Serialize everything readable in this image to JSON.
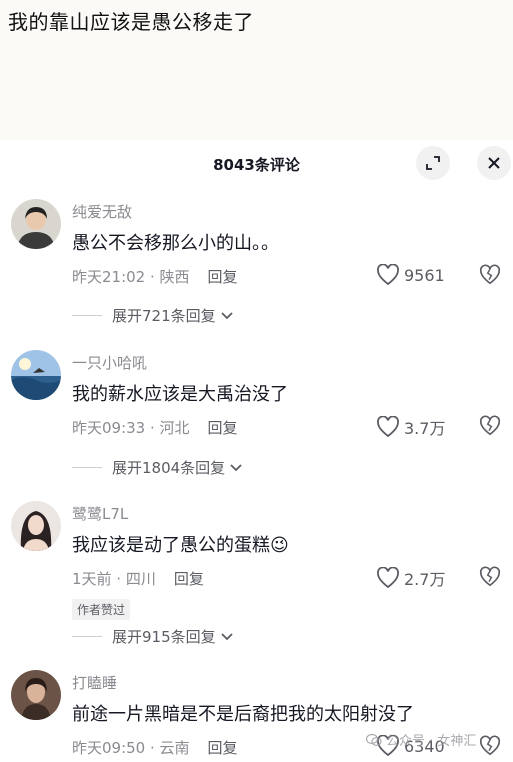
{
  "post": {
    "title": "我的靠山应该是愚公移走了"
  },
  "sheet": {
    "count_title": "8043条评论"
  },
  "comments": [
    {
      "user": "纯爱无敌",
      "text": "愚公不会移那么小的山。。",
      "time_loc": "昨天21:02 · 陕西",
      "reply": "回复",
      "likes": "9561",
      "expand": "展开721条回复"
    },
    {
      "user": "一只小哈吼",
      "text": "我的薪水应该是大禹治没了",
      "time_loc": "昨天09:33 · 河北",
      "reply": "回复",
      "likes": "3.7万",
      "expand": "展开1804条回复"
    },
    {
      "user": "鹭鹭L7L",
      "text": "我应该是动了愚公的蛋糕",
      "emoji": "😉",
      "time_loc": "1天前 · 四川",
      "reply": "回复",
      "likes": "2.7万",
      "author_tag": "作者赞过",
      "expand": "展开915条回复"
    },
    {
      "user": "打瞌睡",
      "text": "前途一片黑暗是不是后裔把我的太阳射没了",
      "time_loc": "昨天09:50 · 云南",
      "reply": "回复",
      "likes": "6340"
    }
  ],
  "watermark": {
    "text": "公众号 · 女神汇"
  },
  "icons": {
    "expand": "expand-arrows-icon",
    "close": "close-icon",
    "like": "heart-icon",
    "dislike": "broken-heart-icon",
    "chevron": "chevron-down-icon"
  }
}
